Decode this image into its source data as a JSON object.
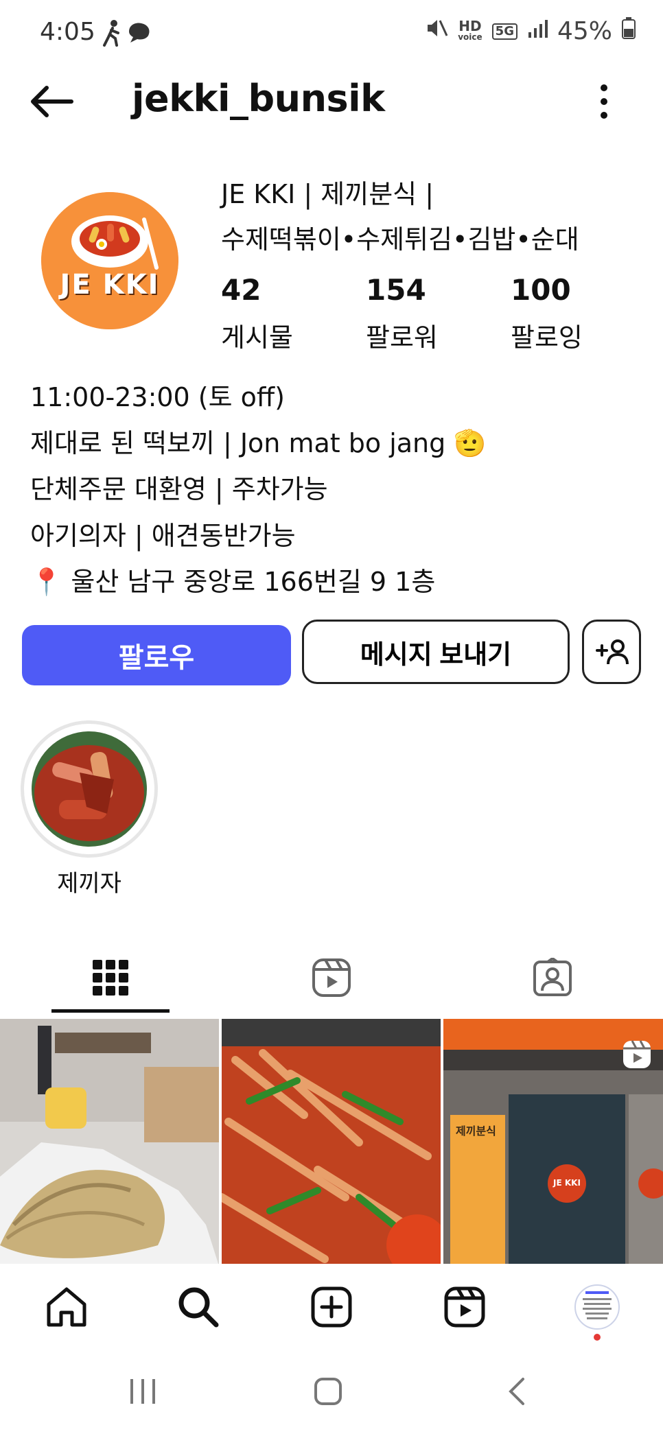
{
  "status_bar": {
    "time": "4:05",
    "battery": "45%",
    "network": "5G",
    "voice": "HD"
  },
  "header": {
    "username": "jekki_bunsik"
  },
  "profile": {
    "avatar_text": "JE KKI",
    "name_line1": "JE KKI | 제끼분식 |",
    "name_line2": "수제떡볶이•수제튀김•김밥•순대",
    "stats": [
      {
        "value": "42",
        "label": "게시물"
      },
      {
        "value": "154",
        "label": "팔로워"
      },
      {
        "value": "100",
        "label": "팔로잉"
      }
    ],
    "bio": [
      "11:00-23:00 (토 off)",
      "제대로 된 떡보끼 | Jon mat bo jang 🫡",
      "단체주문 대환영 | 주차가능",
      "아기의자 | 애견동반가능",
      "📍 울산 남구 중앙로 166번길 9 1층"
    ]
  },
  "buttons": {
    "follow": "팔로우",
    "message": "메시지 보내기"
  },
  "highlights": [
    {
      "label": "제끼자"
    }
  ],
  "tabs": [
    "grid-icon",
    "reels-icon",
    "tagged-icon"
  ],
  "posts": [
    {
      "kind": "photo",
      "desc": "skewers"
    },
    {
      "kind": "photo",
      "desc": "stir-fry"
    },
    {
      "kind": "reel",
      "storefront_text": "JE KKI",
      "sign_text": "제끼분식"
    }
  ],
  "colors": {
    "follow_button": "#4f5bf6",
    "avatar_bg": "#f7913a",
    "live_dot": "#e53935"
  }
}
